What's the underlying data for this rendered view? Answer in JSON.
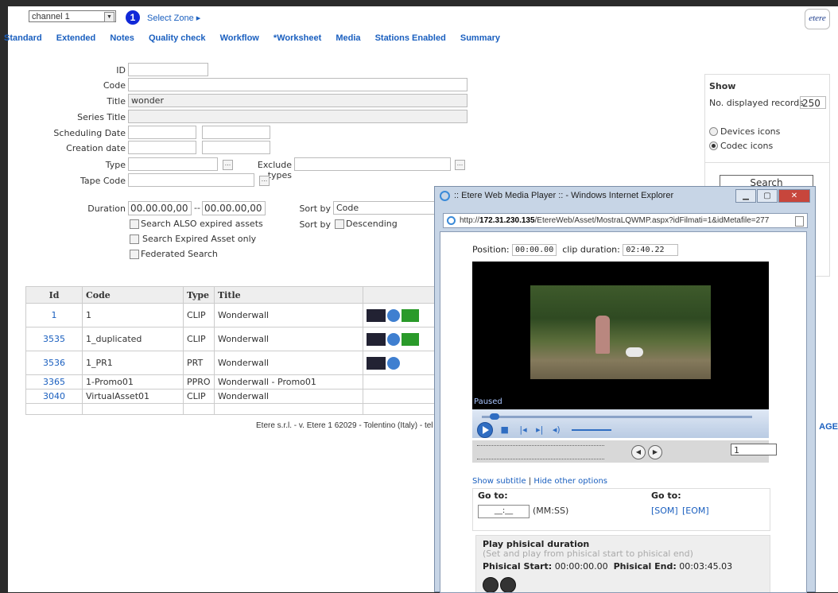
{
  "topbar": {
    "channel": "channel 1",
    "step": "1",
    "select_zone": "Select Zone ▸",
    "logo": "etere"
  },
  "tabs": [
    "Standard",
    "Extended",
    "Notes",
    "Quality check",
    "Workflow",
    "*Worksheet",
    "Media",
    "Stations Enabled",
    "Summary"
  ],
  "form": {
    "id_label": "ID",
    "code_label": "Code",
    "title_label": "Title",
    "title_value": "wonder",
    "series_title_label": "Series Title",
    "scheduling_date_label": "Scheduling Date",
    "creation_date_label": "Creation date",
    "type_label": "Type",
    "exclude_types_label": "Exclude types",
    "tape_code_label": "Tape Code",
    "duration_label": "Duration",
    "duration_from": "00.00.00,00",
    "duration_sep": "--",
    "duration_to": "00.00.00,00",
    "sort_by_label": "Sort by",
    "sort_by_value": "Code",
    "sort_by2_label": "Sort by",
    "descending_label": "Descending",
    "search_also_expired": "Search ALSO expired assets",
    "search_expired_only": "Search Expired Asset only",
    "federated_search": "Federated Search",
    "dots": "..."
  },
  "show_panel": {
    "title": "Show",
    "displayed_label": "No. displayed records",
    "displayed_value": "250",
    "devices_icons": "Devices icons",
    "codec_icons": "Codec icons",
    "search_button": "Search"
  },
  "table": {
    "headers": [
      "Id",
      "Code",
      "Type",
      "Title"
    ],
    "rows": [
      {
        "id": "1",
        "code": "1",
        "type": "CLIP",
        "title": "Wonderwall",
        "icons": [
          "mxf-icon",
          "download-icon",
          "sea-icon"
        ]
      },
      {
        "id": "3535",
        "code": "1_duplicated",
        "type": "CLIP",
        "title": "Wonderwall",
        "icons": [
          "mxf-icon",
          "download-icon",
          "sea-icon"
        ]
      },
      {
        "id": "3536",
        "code": "1_PR1",
        "type": "PRT",
        "title": "Wonderwall",
        "icons": [
          "mxf-icon",
          "download-icon"
        ]
      },
      {
        "id": "3365",
        "code": "1-Promo01",
        "type": "PPRO",
        "title": "Wonderwall - Promo01",
        "icons": []
      },
      {
        "id": "3040",
        "code": "VirtualAsset01",
        "type": "CLIP",
        "title": "Wonderwall",
        "icons": []
      }
    ]
  },
  "footer": {
    "text": "Etere s.r.l. - v.  Etere 1 62029 - Tolentino (Italy) - tel",
    "age": "AGE"
  },
  "popup": {
    "title": ":: Etere Web Media Player :: - Windows Internet Explorer",
    "url_prefix": "http://",
    "url_host": "172.31.230.135",
    "url_path": "/EtereWeb/Asset/MostraLQWMP.aspx?idFilmati=1&idMetafile=277",
    "position_label": "Position:",
    "position_value": "00:00.00",
    "clip_duration_label": "clip duration:",
    "clip_duration_value": "02:40.22",
    "paused": "Paused",
    "frame_value": "1",
    "show_subtitle": "Show subtitle",
    "link_sep": "|",
    "hide_other_options": "Hide other options",
    "goto_label": "Go to:",
    "goto2_label": "Go to:",
    "goto_field": "__:__",
    "goto_format": "(MM:SS)",
    "som": "[SOM]",
    "eom": "[EOM]",
    "physical_title": "Play phisical duration",
    "physical_sub": "(Set and play from phisical start to phisical end)",
    "physical_start_label": "Phisical Start:",
    "physical_start_value": "00:00:00.00",
    "physical_end_label": "Phisical End:",
    "physical_end_value": "00:03:45.03"
  }
}
